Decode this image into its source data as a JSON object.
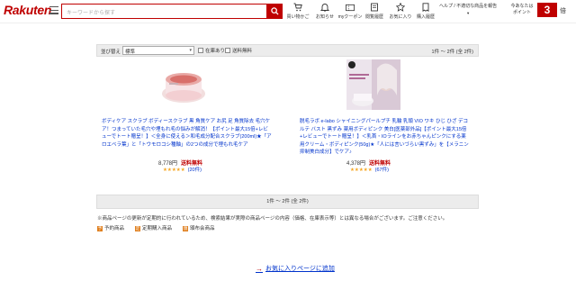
{
  "header": {
    "logo": "Rakuten",
    "search_placeholder": "キーワードから探す",
    "nav": [
      {
        "label": "買い物かご",
        "icon": "cart-icon"
      },
      {
        "label": "お知らせ",
        "icon": "bell-icon"
      },
      {
        "label": "myクーポン",
        "icon": "coupon-icon"
      },
      {
        "label": "閲覧履歴",
        "icon": "history-icon"
      },
      {
        "label": "お気に入り",
        "icon": "star-icon"
      },
      {
        "label": "購入履歴",
        "icon": "receipt-icon"
      }
    ],
    "help_line1": "ヘルプ / 不適切な商品を報告",
    "help_line2": "▼",
    "points_line1": "今あなたは",
    "points_line2": "ポイント",
    "points_value": "3",
    "points_unit": "倍",
    "accent": "#bf0000"
  },
  "sortbar": {
    "label": "並び替え",
    "selected": "標準",
    "in_stock": "在庫あり",
    "free_shipping": "送料無料",
    "count": "1件 ～ 2件 (全 2件)"
  },
  "items": [
    {
      "title": "ボディケア スクラブ ボディースクラブ 黒 角質ケア お尻 足 角質除去 毛穴ケア！つまっていた毛穴や埋もれ毛の悩みが解消！【ポイント最大15倍+レビューでトート贈呈！】＜全身に使える＞和毛成分配合スクラブ(200ml)★「アロエベラ葉」と「トウモロコシ種軸」の2つの成分で埋もれ毛ケア",
      "price": "8,778円",
      "shipping": "送料無料",
      "stars": "★★★★★",
      "reviews": "(20件)"
    },
    {
      "title": "脱毛ラボ e-labo シャイニングパールプチ 乳輪 乳頭 VIO ワキ ひじ ひざ デコルテ バスト 黒ずみ 薬用ボディピンク 美白[医薬部外品]【ポイント最大15倍+レビューでトート贈呈！】＜乳首・IOラインをお赤ちゃんピンクにする薬用クリーム・ボディピンク(50g)★「人には言いづらい黒ずみ」を【メラニン抑制美白成分】でケア♪",
      "price": "4,378円",
      "shipping": "送料無料",
      "stars": "★★★★★",
      "reviews": "(67件)"
    }
  ],
  "pager": "1件 ～ 2件 (全 2件)",
  "note": "※商品ページの更新が定期的に行われているため、検索結果が実際の商品ページの内容（価格、在庫表示等）とは異なる場合がございます。ご注意ください。",
  "legend": [
    {
      "tag": "予",
      "label": "予約商品",
      "color": "#e08020"
    },
    {
      "tag": "定",
      "label": "定期購入商品",
      "color": "#e08020"
    },
    {
      "tag": "頒",
      "label": "頒布会商品",
      "color": "#e08020"
    }
  ],
  "fav_link": "お気に入りページに追加"
}
